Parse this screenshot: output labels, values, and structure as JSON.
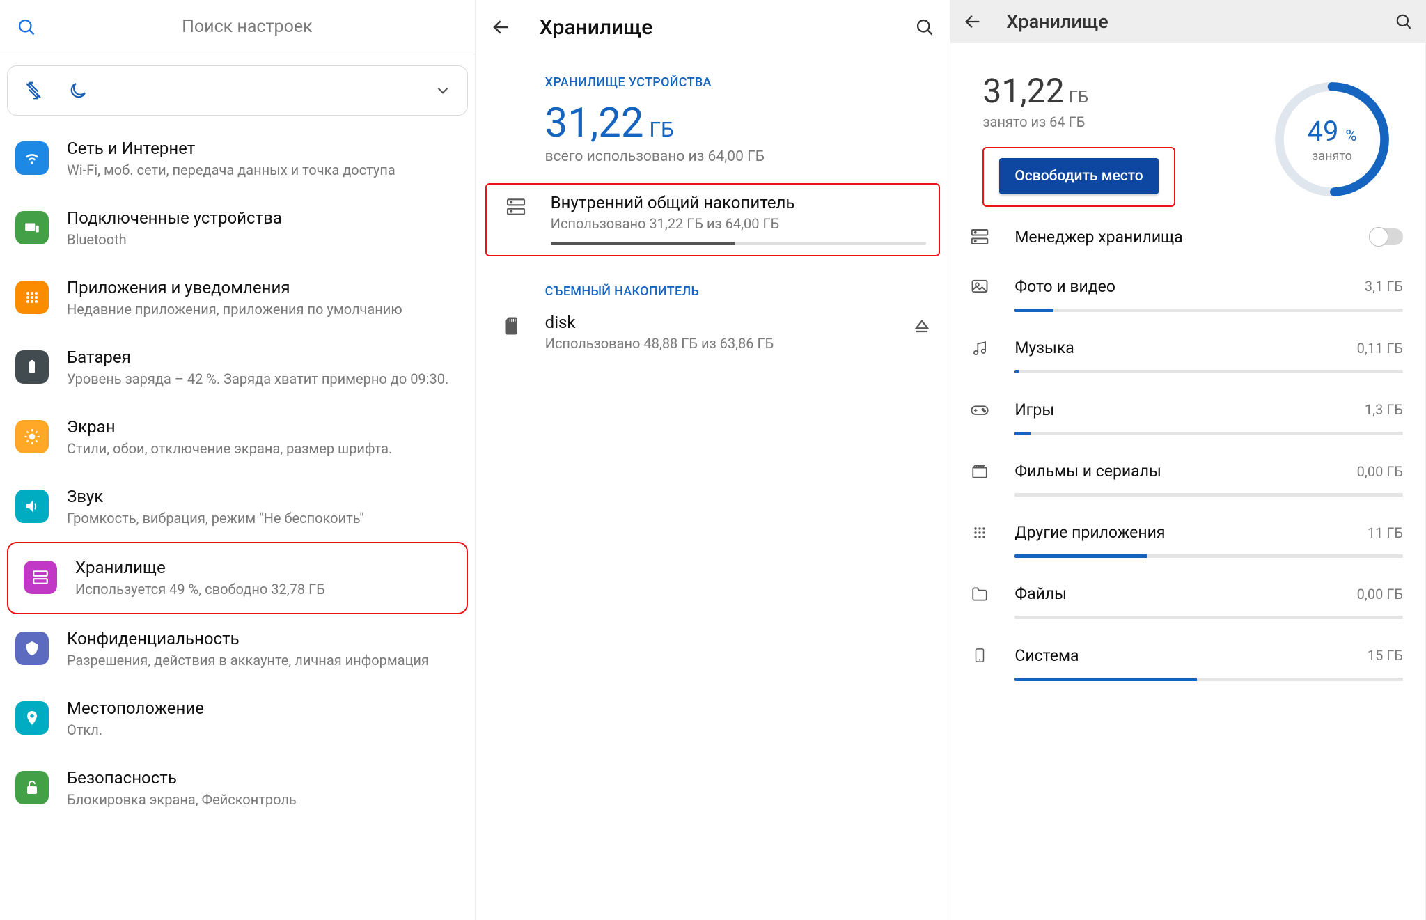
{
  "p1": {
    "search_ph": "Поиск настроек",
    "items": [
      {
        "title": "Сеть и Интернет",
        "sub": "Wi-Fi, моб. сети, передача данных и точка доступа",
        "bg": "#1e88e5",
        "glyph": "wifi"
      },
      {
        "title": "Подключенные устройства",
        "sub": "Bluetooth",
        "bg": "#43a047",
        "glyph": "devices"
      },
      {
        "title": "Приложения и уведомления",
        "sub": "Недавние приложения, приложения по умолчанию",
        "bg": "#fb8c00",
        "glyph": "apps"
      },
      {
        "title": "Батарея",
        "sub": "Уровень заряда – 42 %. Заряда хватит примерно до 09:30.",
        "bg": "#424c50",
        "glyph": "battery"
      },
      {
        "title": "Экран",
        "sub": "Стили, обои, отключение экрана, размер шрифта.",
        "bg": "#ffa726",
        "glyph": "brightness"
      },
      {
        "title": "Звук",
        "sub": "Громкость, вибрация, режим \"Не беспокоить\"",
        "bg": "#00acc1",
        "glyph": "sound"
      },
      {
        "title": "Хранилище",
        "sub": "Используется 49 %, свободно 32,78 ГБ",
        "bg": "#c238c6",
        "glyph": "storage",
        "hl": true
      },
      {
        "title": "Конфиденциальность",
        "sub": "Разрешения, действия в аккаунте, личная информация",
        "bg": "#5c6bc0",
        "glyph": "privacy"
      },
      {
        "title": "Местоположение",
        "sub": "Откл.",
        "bg": "#00acc1",
        "glyph": "location"
      },
      {
        "title": "Безопасность",
        "sub": "Блокировка экрана, Фейсконтроль",
        "bg": "#43a047",
        "glyph": "lock"
      }
    ]
  },
  "p2": {
    "title": "Хранилище",
    "sect1": "ХРАНИЛИЩЕ УСТРОЙСТВА",
    "big_val": "31,22",
    "big_unit": "ГБ",
    "big_sub": "всего использовано из 64,00 ГБ",
    "internal": {
      "title": "Внутренний общий накопитель",
      "sub": "Использовано 31,22 ГБ из 64,00 ГБ",
      "pct": 49
    },
    "sect2": "СЪЕМНЫЙ НАКОПИТЕЛЬ",
    "disk": {
      "title": "disk",
      "sub": "Использовано 48,88 ГБ из 63,86 ГБ"
    }
  },
  "p3": {
    "title": "Хранилище",
    "val": "31,22",
    "unit": "ГБ",
    "sub": "занято из 64 ГБ",
    "free_btn": "Освободить место",
    "pct": "49",
    "pct_word": "занято",
    "mgr": "Менеджер хранилища",
    "cats": [
      {
        "name": "Фото и видео",
        "val": "3,1 ГБ",
        "pct": 10,
        "glyph": "photo"
      },
      {
        "name": "Музыка",
        "val": "0,11 ГБ",
        "pct": 1,
        "glyph": "music"
      },
      {
        "name": "Игры",
        "val": "1,3 ГБ",
        "pct": 4,
        "glyph": "games"
      },
      {
        "name": "Фильмы и сериалы",
        "val": "0,00 ГБ",
        "pct": 0,
        "glyph": "movies"
      },
      {
        "name": "Другие приложения",
        "val": "11 ГБ",
        "pct": 34,
        "glyph": "apps2"
      },
      {
        "name": "Файлы",
        "val": "0,00 ГБ",
        "pct": 0,
        "glyph": "folder"
      },
      {
        "name": "Система",
        "val": "15 ГБ",
        "pct": 47,
        "glyph": "system"
      }
    ]
  }
}
